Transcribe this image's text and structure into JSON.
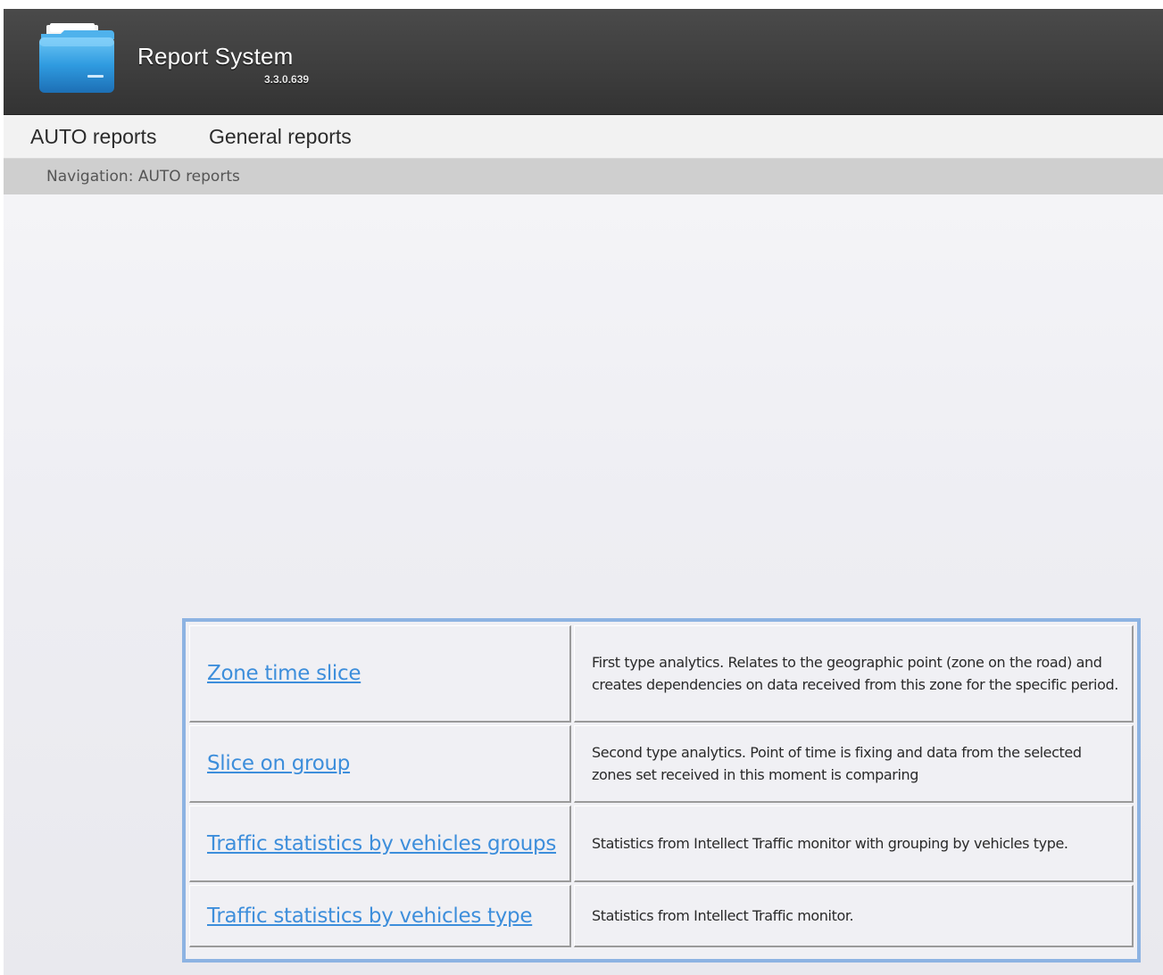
{
  "header": {
    "title": "Report System",
    "version": "3.3.0.639",
    "logo": "folder-icon"
  },
  "menu": {
    "items": [
      {
        "label": "AUTO reports"
      },
      {
        "label": "General reports"
      }
    ]
  },
  "navigation": {
    "text": "Navigation: AUTO reports"
  },
  "reports": [
    {
      "name": "Zone time slice",
      "description": "First type analytics. Relates to the geographic point (zone on the road) and creates dependencies on data received from this zone for the specific period."
    },
    {
      "name": "Slice on group",
      "description": "Second type analytics. Point of time is fixing and data from the selected zones set received in this moment is comparing"
    },
    {
      "name": "Traffic statistics by vehicles groups",
      "description": "Statistics from Intellect Traffic monitor with grouping by vehicles type."
    },
    {
      "name": "Traffic statistics by vehicles type",
      "description": "Statistics from Intellect Traffic monitor."
    }
  ],
  "colors": {
    "header_bg": "#3d3d3d",
    "link": "#3d8edb",
    "table_border": "#8db3e2",
    "nav_bg": "#cfcfcf"
  }
}
